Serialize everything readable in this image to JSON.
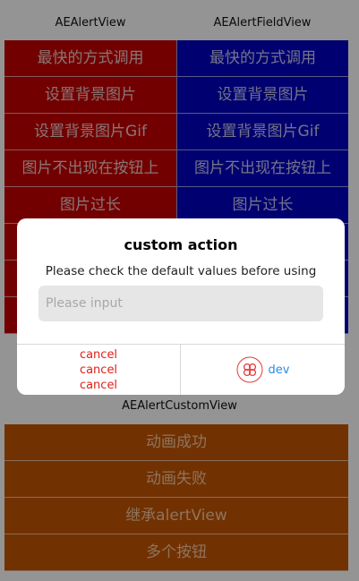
{
  "sections": {
    "alert_view_title": "AEAlertView",
    "field_view_title": "AEAlertFieldView",
    "custom_view_title": "AEAlertCustomView"
  },
  "alert_view_items": [
    "最快的方式调用",
    "设置背景图片",
    "设置背景图片Gif",
    "图片不出现在按钮上",
    "图片过长",
    "",
    "",
    ""
  ],
  "field_view_items": [
    "最快的方式调用",
    "设置背景图片",
    "设置背景图片Gif",
    "图片不出现在按钮上",
    "图片过长",
    "",
    "",
    ""
  ],
  "custom_view_items": [
    "动画成功",
    "动画失败",
    "继承alertView",
    "多个按钮"
  ],
  "dialog": {
    "title": "custom action",
    "message": "Please check the default values before using",
    "input_placeholder": "Please input",
    "input_value": "",
    "cancel_lines": [
      "cancel",
      "cancel",
      "cancel"
    ],
    "dev_label": "dev",
    "dev_icon": "clover-icon"
  },
  "colors": {
    "alert_red": "#c40000",
    "field_blue": "#0000c2",
    "custom_orange": "#c45500",
    "cancel_red": "#e0201a",
    "dev_blue": "#2b8be6"
  }
}
